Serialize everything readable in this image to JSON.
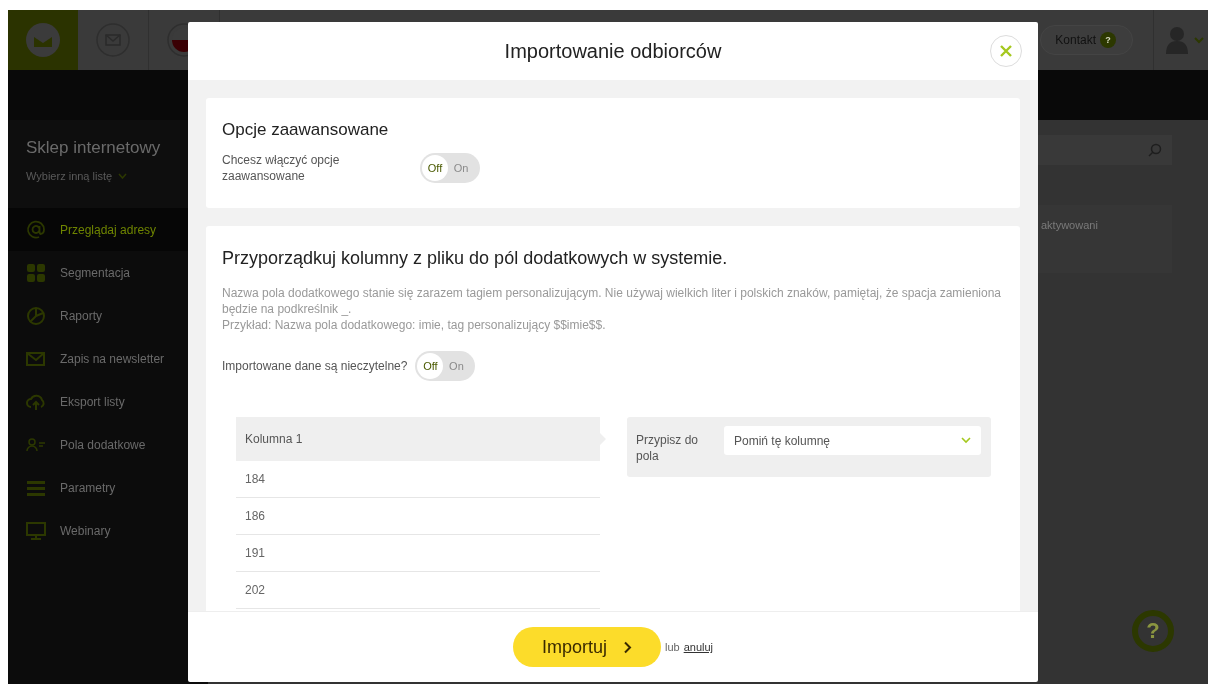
{
  "app": {
    "topbar": {
      "contact_label": "Kontakt",
      "contact_badge": "?"
    },
    "sidebar": {
      "list_title": "Sklep internetowy",
      "list_switch": "Wybierz inną listę",
      "items": [
        {
          "label": "Przeglądaj adresy",
          "selected": true
        },
        {
          "label": "Segmentacja",
          "selected": false
        },
        {
          "label": "Raporty",
          "selected": false
        },
        {
          "label": "Zapis na newsletter",
          "selected": false
        },
        {
          "label": "Eksport listy",
          "selected": false
        },
        {
          "label": "Pola dodatkowe",
          "selected": false
        },
        {
          "label": "Parametry",
          "selected": false
        },
        {
          "label": "Webinary",
          "selected": false
        }
      ]
    },
    "content": {
      "status_fragment": "aktywowani"
    },
    "help_button": "?"
  },
  "modal": {
    "title": "Importowanie odbiorców",
    "advanced": {
      "heading": "Opcje zaawansowane",
      "label": "Chcesz włączyć opcje zaawansowane",
      "toggle": {
        "on": false,
        "off_label": "Off",
        "on_label": "On"
      }
    },
    "mapping": {
      "heading": "Przyporządkuj kolumny z pliku do pól dodatkowych w systemie.",
      "description": [
        "Nazwa pola dodatkowego stanie się zarazem tagiem personalizującym. Nie używaj wielkich liter i polskich znaków, pamiętaj, że spacja zamieniona będzie na podkreślnik _.",
        "Przykład: Nazwa pola dodatkowego: imie, tag personalizujący $$imie$$."
      ],
      "unreadable": {
        "label": "Importowane dane są nieczytelne?",
        "toggle": {
          "on": false,
          "off_label": "Off",
          "on_label": "On"
        }
      },
      "column": {
        "header": "Kolumna 1",
        "values": [
          "184",
          "186",
          "191",
          "202"
        ]
      },
      "assign": {
        "label": "Przypisz do pola",
        "value": "Pomiń tę kolumnę"
      }
    },
    "footer": {
      "import_button": "Importuj",
      "or": "lub",
      "cancel": "anuluj"
    }
  }
}
